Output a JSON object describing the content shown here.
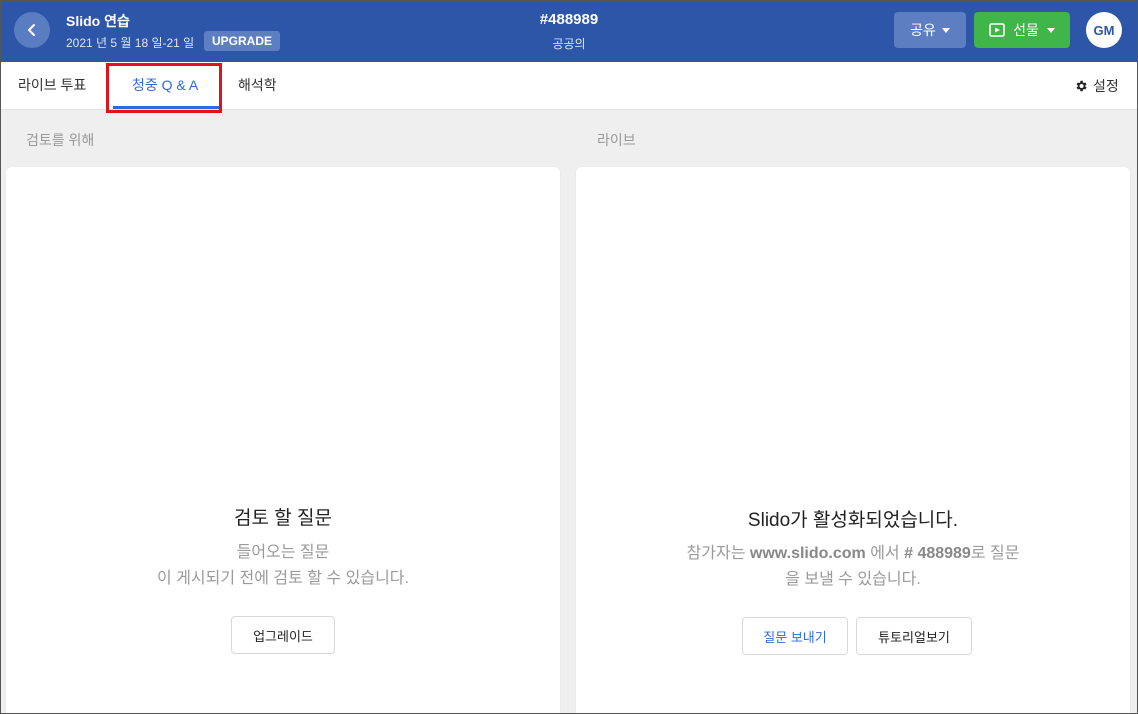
{
  "header": {
    "title": "Slido 연습",
    "date": "2021 년 5 월 18 일-21 일",
    "upgrade_badge": "UPGRADE",
    "event_code": "#488989",
    "event_name": "공공의",
    "share_label": "공유",
    "present_label": "선물",
    "avatar_initials": "GM"
  },
  "tabs": [
    {
      "label": "라이브 투표"
    },
    {
      "label": "청중 Q & A"
    },
    {
      "label": "해석학"
    }
  ],
  "settings_label": "설정",
  "review": {
    "column_label": "검토를 위해",
    "title": "검토 할 질문",
    "desc_line1": "들어오는 질문",
    "desc_line2": "이 게시되기 전에 검토 할 수 있습니다.",
    "upgrade_button": "업그레이드"
  },
  "live": {
    "column_label": "라이브",
    "title_brand": "Slido",
    "title_rest": "가 활성화되었습니다.",
    "desc_prefix": "참가자는 ",
    "desc_url": "www.slido.com",
    "desc_mid": " 에서 ",
    "desc_code": "# 488989",
    "desc_suffix": "로 질문",
    "desc_line2": "을 보낼 수 있습니다.",
    "send_question_button": "질문 보내기",
    "tutorial_button": "튜토리얼보기"
  },
  "colors": {
    "header_bg": "#2d56a8",
    "present_green": "#3fb54a",
    "active_tab": "#2d6ae0",
    "highlight_red": "#e0131b"
  }
}
